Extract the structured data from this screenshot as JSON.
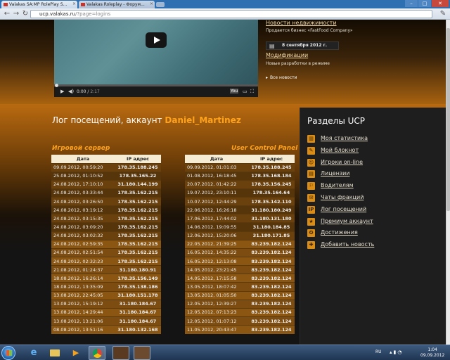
{
  "browser": {
    "tabs": [
      {
        "title": "Valakas SA:MP RolePlay S..."
      },
      {
        "title": "Valakas Roleplay - Форум..."
      }
    ],
    "url_host": "ucp.valakas.ru",
    "url_path": "/?page=logins"
  },
  "video": {
    "time_current": "0:00",
    "time_total": "2:17",
    "brand": "You"
  },
  "news": {
    "item1_title": "Новости недвижимости",
    "item1_text": "Продается бизнес «FastFood Company»",
    "date": "8 сентября 2012 г.",
    "item2_title": "Модификации",
    "item2_text": "Новые разработки в режиме",
    "all_news": "Все новости"
  },
  "log": {
    "title_prefix": "Лог посещений, аккаунт",
    "account": "Daniel_Martinez",
    "game_label": "Игровой сервер",
    "ucp_label": "User Control Panel",
    "col_date": "Дата",
    "col_ip": "IP адрес",
    "game_rows": [
      {
        "date": "09.09.2012, 00:59:20",
        "ip": "178.35.188.245"
      },
      {
        "date": "25.08.2012, 01:10:52",
        "ip": "178.35.165.22"
      },
      {
        "date": "24.08.2012, 17:10:10",
        "ip": "31.180.144.199"
      },
      {
        "date": "24.08.2012, 03:33:44",
        "ip": "178.35.162.215"
      },
      {
        "date": "24.08.2012, 03:26:50",
        "ip": "178.35.162.215"
      },
      {
        "date": "24.08.2012, 03:19:12",
        "ip": "178.35.162.215"
      },
      {
        "date": "24.08.2012, 03:15:35",
        "ip": "178.35.162.215"
      },
      {
        "date": "24.08.2012, 03:09:20",
        "ip": "178.35.162.215"
      },
      {
        "date": "24.08.2012, 03:02:32",
        "ip": "178.35.162.215"
      },
      {
        "date": "24.08.2012, 02:59:35",
        "ip": "178.35.162.215"
      },
      {
        "date": "24.08.2012, 02:51:54",
        "ip": "178.35.162.215"
      },
      {
        "date": "24.08.2012, 02:32:23",
        "ip": "178.35.162.215"
      },
      {
        "date": "21.08.2012, 01:24:37",
        "ip": "31.180.180.91"
      },
      {
        "date": "18.08.2012, 16:26:14",
        "ip": "178.35.156.149"
      },
      {
        "date": "18.08.2012, 13:35:09",
        "ip": "178.35.138.186"
      },
      {
        "date": "13.08.2012, 22:45:05",
        "ip": "31.180.151.178"
      },
      {
        "date": "13.08.2012, 15:19:12",
        "ip": "31.180.184.67"
      },
      {
        "date": "13.08.2012, 14:29:44",
        "ip": "31.180.184.67"
      },
      {
        "date": "13.08.2012, 13:21:06",
        "ip": "31.180.184.67"
      },
      {
        "date": "08.08.2012, 13:51:16",
        "ip": "31.180.132.168"
      }
    ],
    "ucp_rows": [
      {
        "date": "09.09.2012, 01:01:03",
        "ip": "178.35.188.245"
      },
      {
        "date": "01.08.2012, 16:18:45",
        "ip": "178.35.168.184"
      },
      {
        "date": "20.07.2012, 01:42:22",
        "ip": "178.35.156.245"
      },
      {
        "date": "19.07.2012, 23:10:11",
        "ip": "178.35.164.64"
      },
      {
        "date": "10.07.2012, 12:44:29",
        "ip": "178.35.142.110"
      },
      {
        "date": "22.06.2012, 16:26:18",
        "ip": "31.180.180.249"
      },
      {
        "date": "17.06.2012, 17:44:02",
        "ip": "31.180.131.180"
      },
      {
        "date": "14.06.2012, 19:09:55",
        "ip": "31.180.184.85"
      },
      {
        "date": "12.06.2012, 15:20:06",
        "ip": "31.180.171.85"
      },
      {
        "date": "22.05.2012, 21:39:25",
        "ip": "83.239.182.124"
      },
      {
        "date": "16.05.2012, 14:35:22",
        "ip": "83.239.182.124"
      },
      {
        "date": "16.05.2012, 12:13:08",
        "ip": "83.239.182.124"
      },
      {
        "date": "14.05.2012, 23:21:45",
        "ip": "83.239.182.124"
      },
      {
        "date": "14.05.2012, 17:15:58",
        "ip": "83.239.182.124"
      },
      {
        "date": "13.05.2012, 18:07:42",
        "ip": "83.239.182.124"
      },
      {
        "date": "13.05.2012, 01:05:50",
        "ip": "83.239.182.124"
      },
      {
        "date": "12.05.2012, 12:39:27",
        "ip": "83.239.182.124"
      },
      {
        "date": "12.05.2012, 07:13:23",
        "ip": "83.239.182.124"
      },
      {
        "date": "12.05.2012, 01:07:12",
        "ip": "83.239.182.124"
      },
      {
        "date": "11.05.2012, 20:43:47",
        "ip": "83.239.182.124"
      }
    ]
  },
  "sidebar": {
    "title": "Разделы UCP",
    "items": [
      {
        "label": "Моя статистика",
        "icon": "stats-icon"
      },
      {
        "label": "Мой блокнот",
        "icon": "notepad-icon"
      },
      {
        "label": "Игроки on-line",
        "icon": "players-icon"
      },
      {
        "label": "Лицензии",
        "icon": "license-icon"
      },
      {
        "label": "Водителям",
        "icon": "driver-icon"
      },
      {
        "label": "Чаты фракций",
        "icon": "chat-icon"
      },
      {
        "label": "Лог посещений",
        "icon": "ip-log-icon"
      },
      {
        "label": "Премиум аккаунт",
        "icon": "premium-icon"
      },
      {
        "label": "Достижения",
        "icon": "achievements-icon"
      },
      {
        "label": "Добавить новость",
        "icon": "add-news-icon"
      }
    ]
  },
  "taskbar": {
    "lang": "RU",
    "time": "1:04",
    "date": "09.09.2012"
  }
}
